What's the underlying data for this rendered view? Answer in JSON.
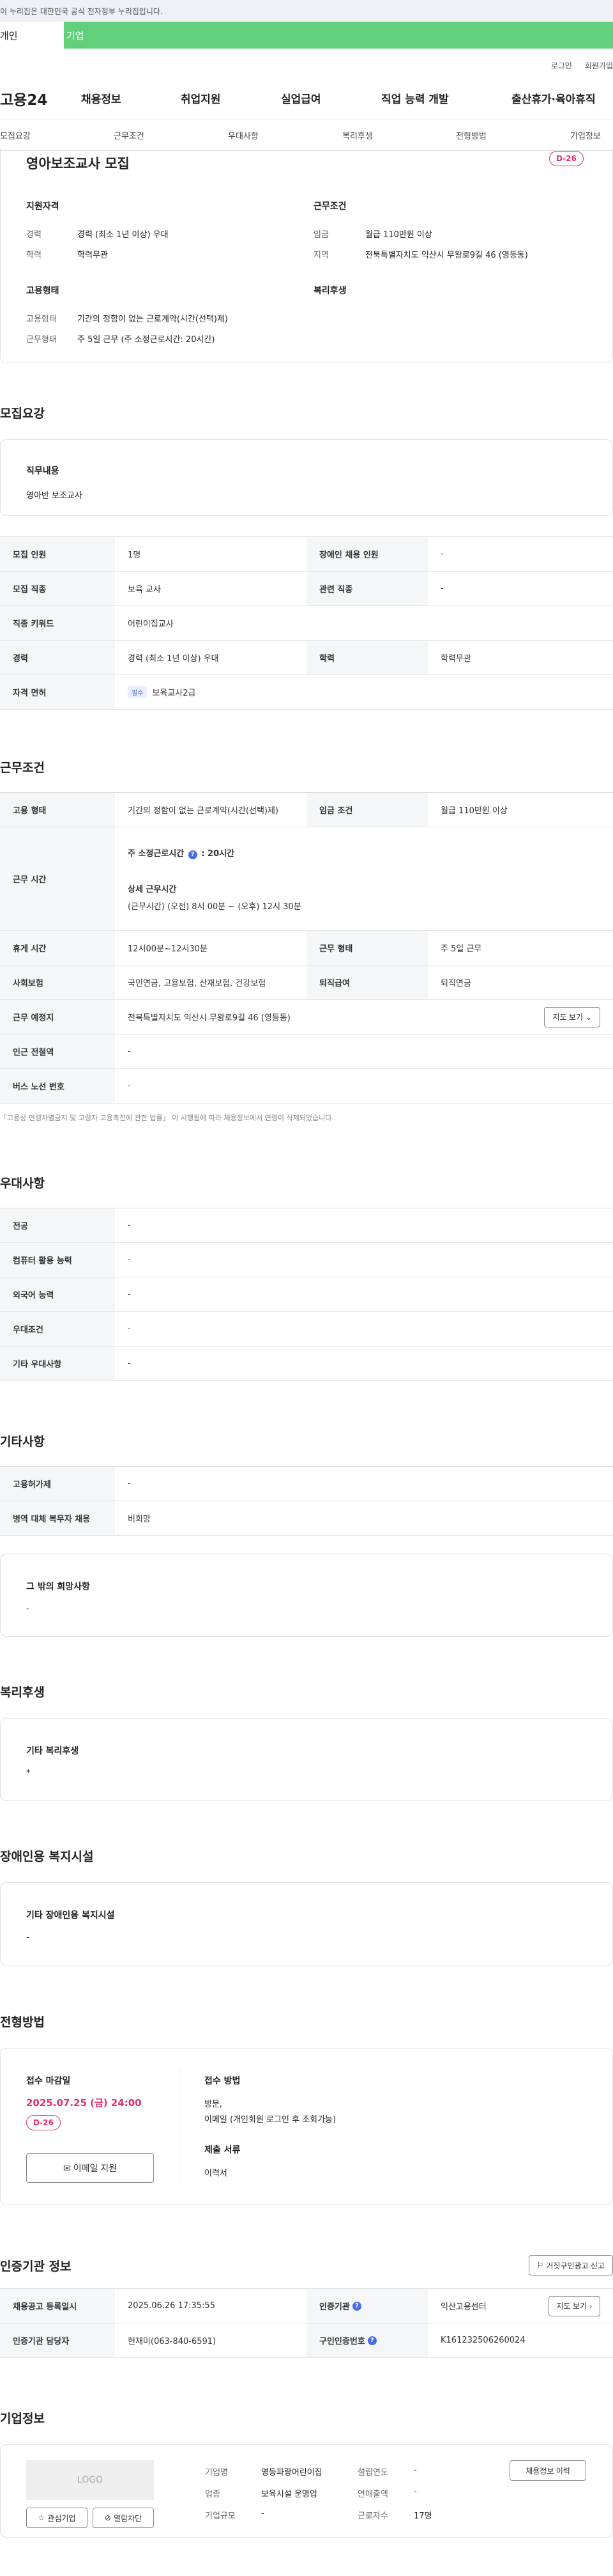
{
  "gov_bar": {
    "text": "이 누리집은 대한민국 공식 전자정부 누리집입니다."
  },
  "user_tabs": {
    "person": "개인",
    "company": "기업"
  },
  "util": {
    "login": "로그인",
    "signup": "회원가입"
  },
  "gnb": {
    "logo": "고용24",
    "items": [
      "채용정보",
      "취업지원",
      "실업급여",
      "직업 능력 개발",
      "출산휴가·육아휴직"
    ]
  },
  "anchor": {
    "items": [
      "모집요강",
      "근무조건",
      "우대사항",
      "복리후생",
      "전형방법",
      "기업정보"
    ]
  },
  "summary": {
    "title": "영아보조교사 모집",
    "dday": "D-26",
    "qual_title": "지원자격",
    "career_label": "경력",
    "career_value": "경력 (최소 1년 이상) 우대",
    "edu_label": "학력",
    "edu_value": "학력무관",
    "work_title": "근무조건",
    "wage_label": "임금",
    "wage_value": "월급 110만원 이상",
    "region_label": "지역",
    "region_value": "전북특별자치도 익산시 무왕로9길 46 (영등동)",
    "emp_title": "고용형태",
    "emp_type_label": "고용형태",
    "emp_type_value": "기간의 정함이 없는 근로계약(시간(선택)제)",
    "work_form_label": "근무형태",
    "work_form_value": "주 5일 근무 (주 소정근로시간: 20시간)",
    "welfare_title": "복리후생"
  },
  "recruit": {
    "title": "모집요강",
    "duty_label": "직무내용",
    "duty_value": "영아반 보조교사",
    "rows": {
      "count_label": "모집 인원",
      "count_value": "1명",
      "disabled_label": "장애인 채용 인원",
      "disabled_value": "-",
      "job_label": "모집 직종",
      "job_value": "보육 교사",
      "rel_label": "관련 직종",
      "rel_value": "-",
      "keyword_label": "직종 키워드",
      "keyword_value": "어린이집교사",
      "career_label": "경력",
      "career_value": "경력 (최소 1년 이상) 우대",
      "edu_label": "학력",
      "edu_value": "학력무관",
      "license_label": "자격 면허",
      "license_badge": "필수",
      "license_value": "보육교사2급"
    }
  },
  "conditions": {
    "title": "근무조건",
    "emp_label": "고용 형태",
    "emp_value": "기간의 정함이 없는 근로계약(시간(선택)제)",
    "wage_label": "임금 조건",
    "wage_value": "월급 110만원 이상",
    "hours_label": "근무 시간",
    "hours_weekly": "주 소정근로시간",
    "hours_weekly_value": ": 20시간",
    "hours_detail_title": "상세 근무시간",
    "hours_detail_value": "(근무시간) (오전) 8시 00분 ~ (오후) 12시 30분",
    "break_label": "휴게 시간",
    "break_value": "12시00분~12시30분",
    "form_label": "근무 형태",
    "form_value": "주 5일 근무",
    "insurance_label": "사회보험",
    "insurance_value": "국민연금, 고용보험, 산재보험, 건강보험",
    "retire_label": "퇴직급여",
    "retire_value": "퇴직연금",
    "place_label": "근무 예정지",
    "place_value": "전북특별자치도 익산시 무왕로9길 46 (영등동)",
    "map_button": "지도 보기",
    "subway_label": "인근 전철역",
    "subway_value": "-",
    "bus_label": "버스 노선 번호",
    "bus_value": "-",
    "note": "「고용상 연령차별금지 및 고령자 고용촉진에 관한 법률」 이 시행됨에 따라 채용정보에서 연령이 삭제되었습니다."
  },
  "preference": {
    "title": "우대사항",
    "major_label": "전공",
    "major_value": "-",
    "computer_label": "컴퓨터 활용 능력",
    "computer_value": "-",
    "lang_label": "외국어 능력",
    "lang_value": "-",
    "pref_label": "우대조건",
    "pref_value": "-",
    "etc_label": "기타 우대사항",
    "etc_value": "-"
  },
  "etc": {
    "title": "기타사항",
    "permit_label": "고용허가제",
    "permit_value": "-",
    "military_label": "병역 대체 복무자 채용",
    "military_value": "비희망",
    "other_title": "그 밖의 희망사항",
    "other_value": "-"
  },
  "welfare": {
    "title": "복리후생",
    "etc_title": "기타 복리후생",
    "etc_value": "*"
  },
  "disabled": {
    "title": "장애인용 복지시설",
    "etc_title": "기타 장애인용 복지시설",
    "etc_value": "-"
  },
  "process": {
    "title": "전형방법",
    "deadline_title": "접수 마감일",
    "deadline_value": "2025.07.25 (금) 24:00",
    "dday": "D-26",
    "email_button": "이메일 지원",
    "method_title": "접수 방법",
    "method_line1": "방문,",
    "method_line2": "이메일 (개인회원 로그인 후 조회가능)",
    "docs_title": "제출 서류",
    "docs_value": "이력서"
  },
  "auth": {
    "title": "인증기관 정보",
    "report_button": "거짓구인광고 신고",
    "reg_label": "채용공고 등록일시",
    "reg_value": "2025.06.26 17:35:55",
    "org_label": "인증기관",
    "org_value": "익산고용센터",
    "map_button": "지도 보기",
    "manager_label": "인증기관 담당자",
    "manager_value": "현재미(063-840-6591)",
    "no_label": "구인인증번호",
    "no_value": "K161232506260024"
  },
  "company": {
    "title": "기업정보",
    "logo_text": "LOGO",
    "fav_button": "관심기업",
    "block_button": "열람차단",
    "name_label": "기업명",
    "name_value": "영등파랑어린이집",
    "founded_label": "설립연도",
    "founded_value": "-",
    "industry_label": "업종",
    "industry_value": "보육시설 운영업",
    "sales_label": "연매출액",
    "sales_value": "-",
    "size_label": "기업규모",
    "size_value": "-",
    "staff_label": "근로자수",
    "staff_value": "17명",
    "history_button": "채용정보 이력"
  }
}
